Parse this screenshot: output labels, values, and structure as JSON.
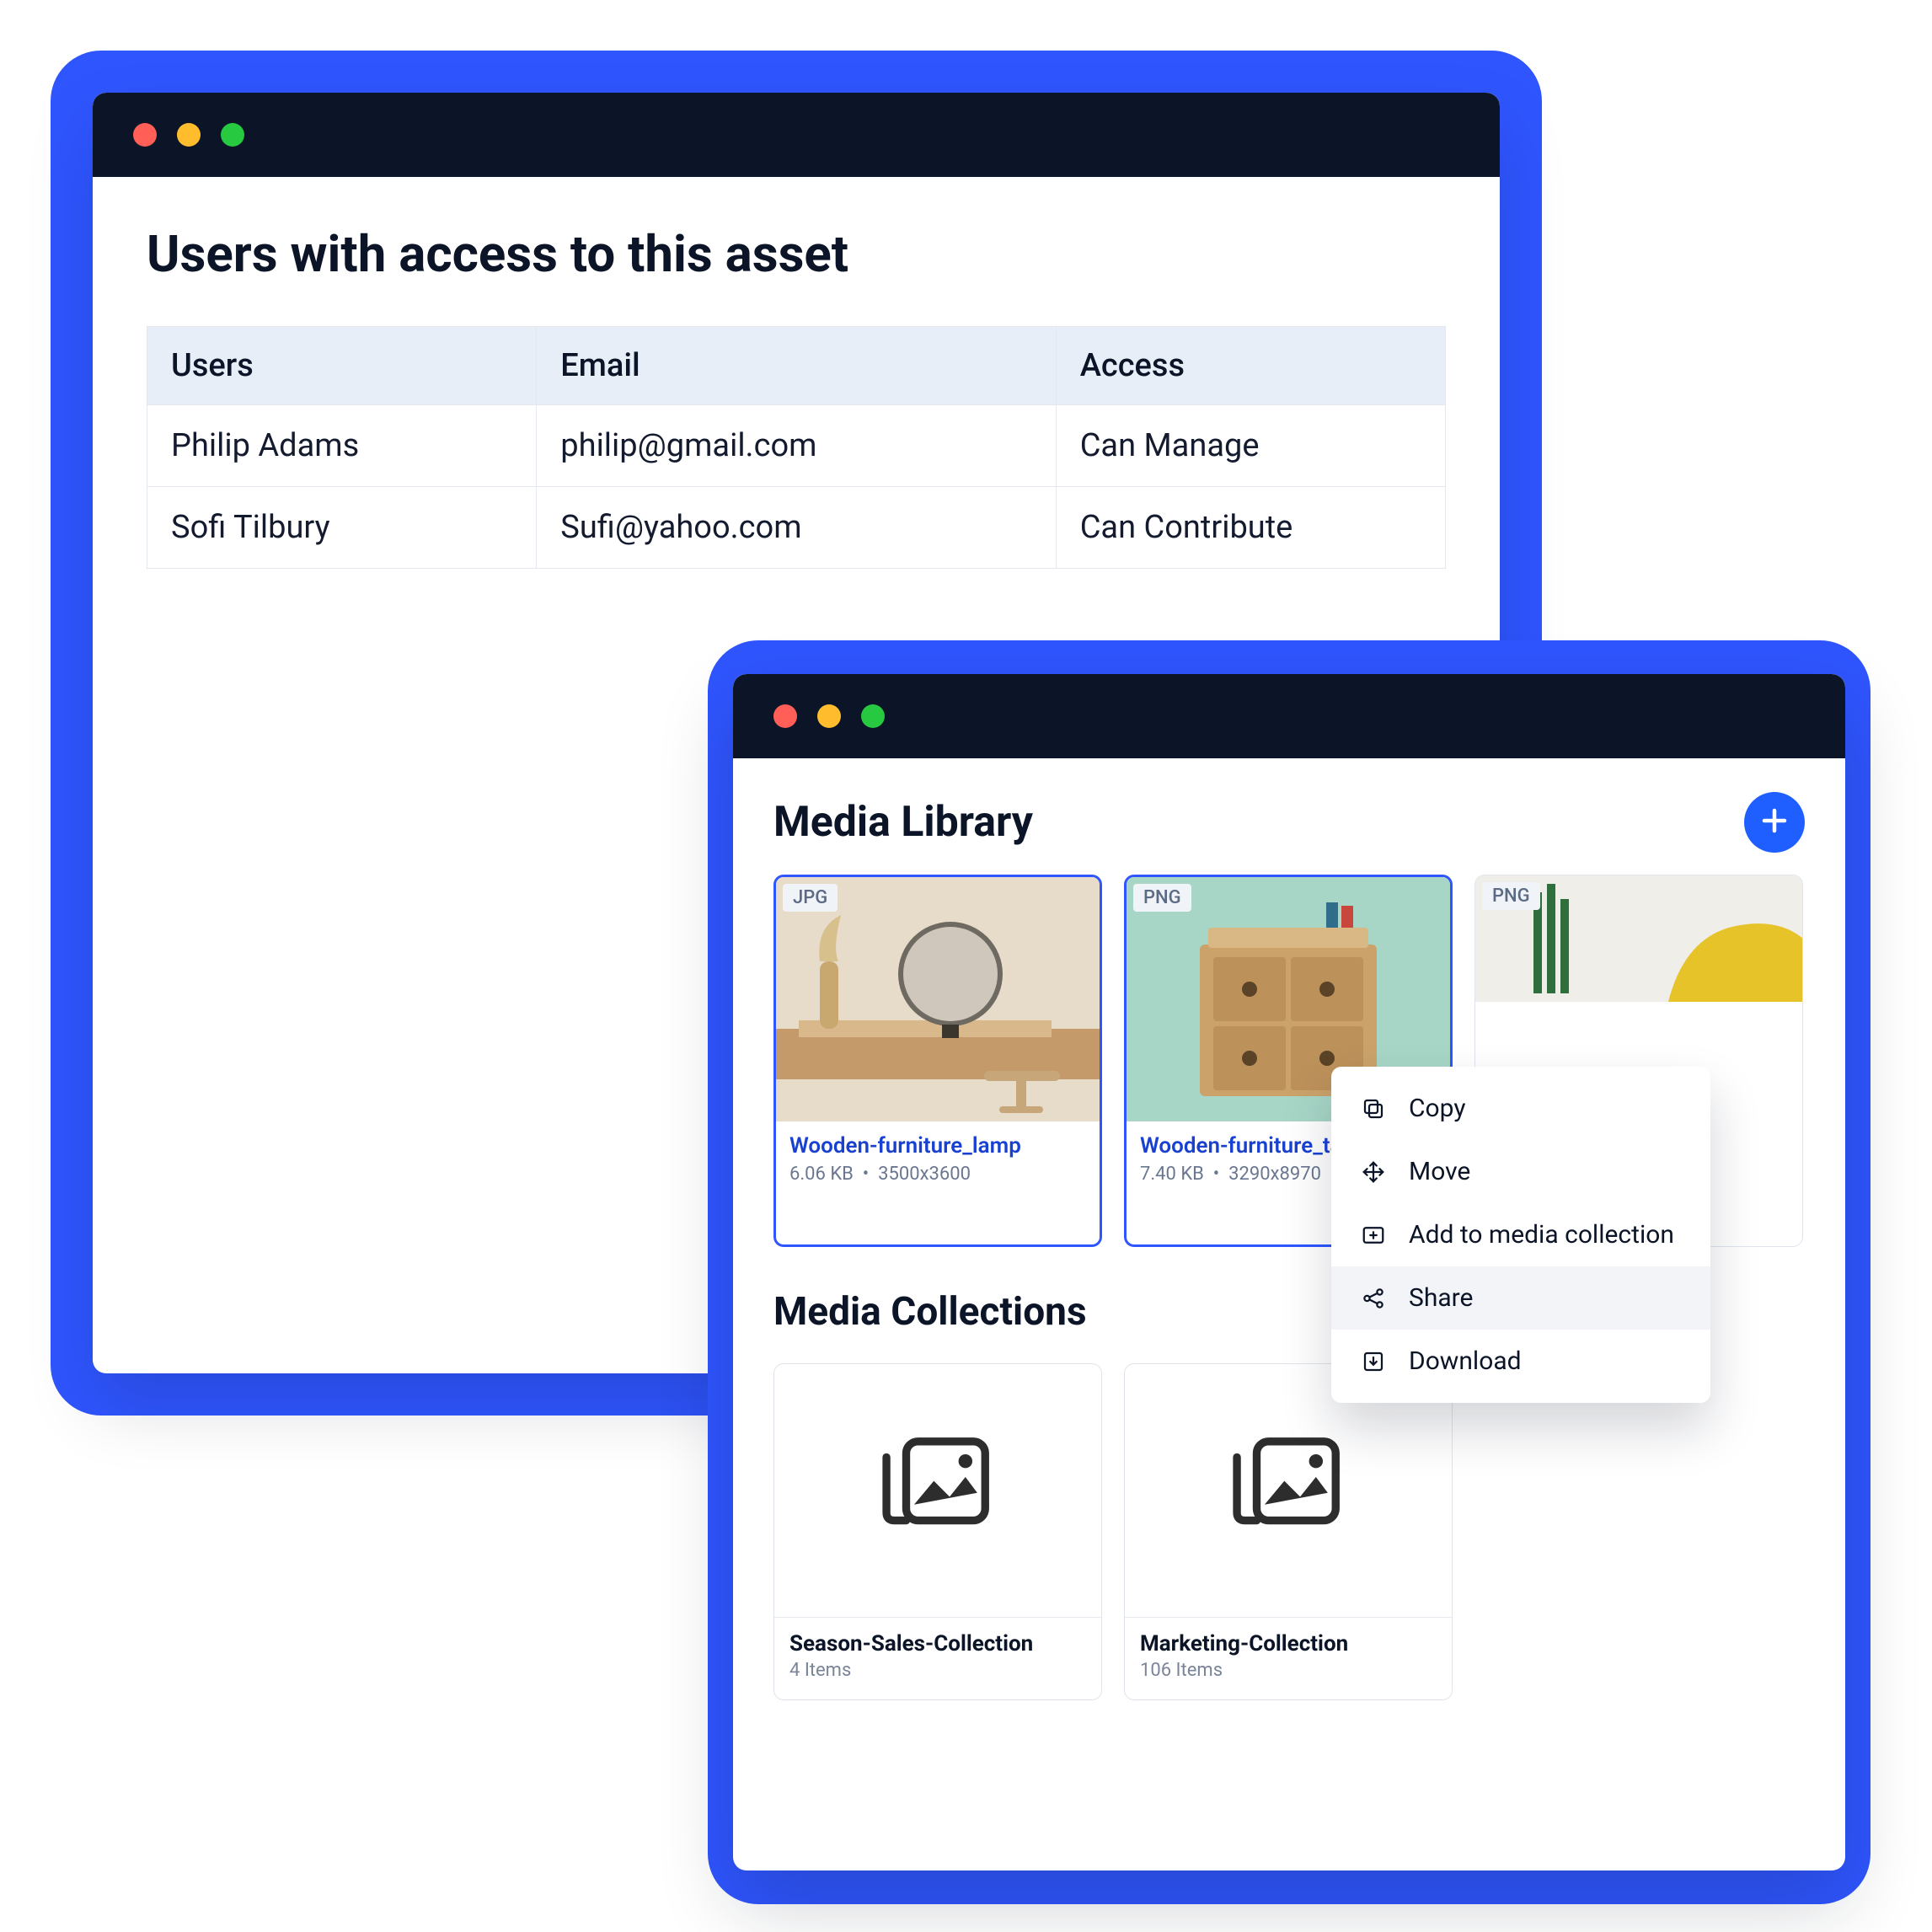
{
  "accessPanel": {
    "title": "Users with access to this asset",
    "columns": {
      "c0": "Users",
      "c1": "Email",
      "c2": "Access"
    },
    "rows": [
      {
        "user": "Philip Adams",
        "email": "philip@gmail.com",
        "access": "Can Manage"
      },
      {
        "user": "Sofi Tilbury",
        "email": "Sufi@yahoo.com",
        "access": "Can Contribute"
      }
    ]
  },
  "mediaLibrary": {
    "title": "Media Library",
    "items": [
      {
        "format": "JPG",
        "name": "Wooden-furniture_lamp",
        "size": "6.06 KB",
        "dims": "3500x3600"
      },
      {
        "format": "PNG",
        "name": "Wooden-furniture_table",
        "size": "7.40 KB",
        "dims": "3290x8970"
      },
      {
        "format": "PNG"
      }
    ]
  },
  "contextMenu": {
    "items": [
      {
        "label": "Copy"
      },
      {
        "label": "Move"
      },
      {
        "label": "Add to media collection"
      },
      {
        "label": "Share"
      },
      {
        "label": "Download"
      }
    ],
    "highlightIndex": 3
  },
  "collections": {
    "title": "Media Collections",
    "items": [
      {
        "name": "Season-Sales-Collection",
        "count": "4 Items"
      },
      {
        "name": "Marketing-Collection",
        "count": "106 Items"
      }
    ]
  }
}
